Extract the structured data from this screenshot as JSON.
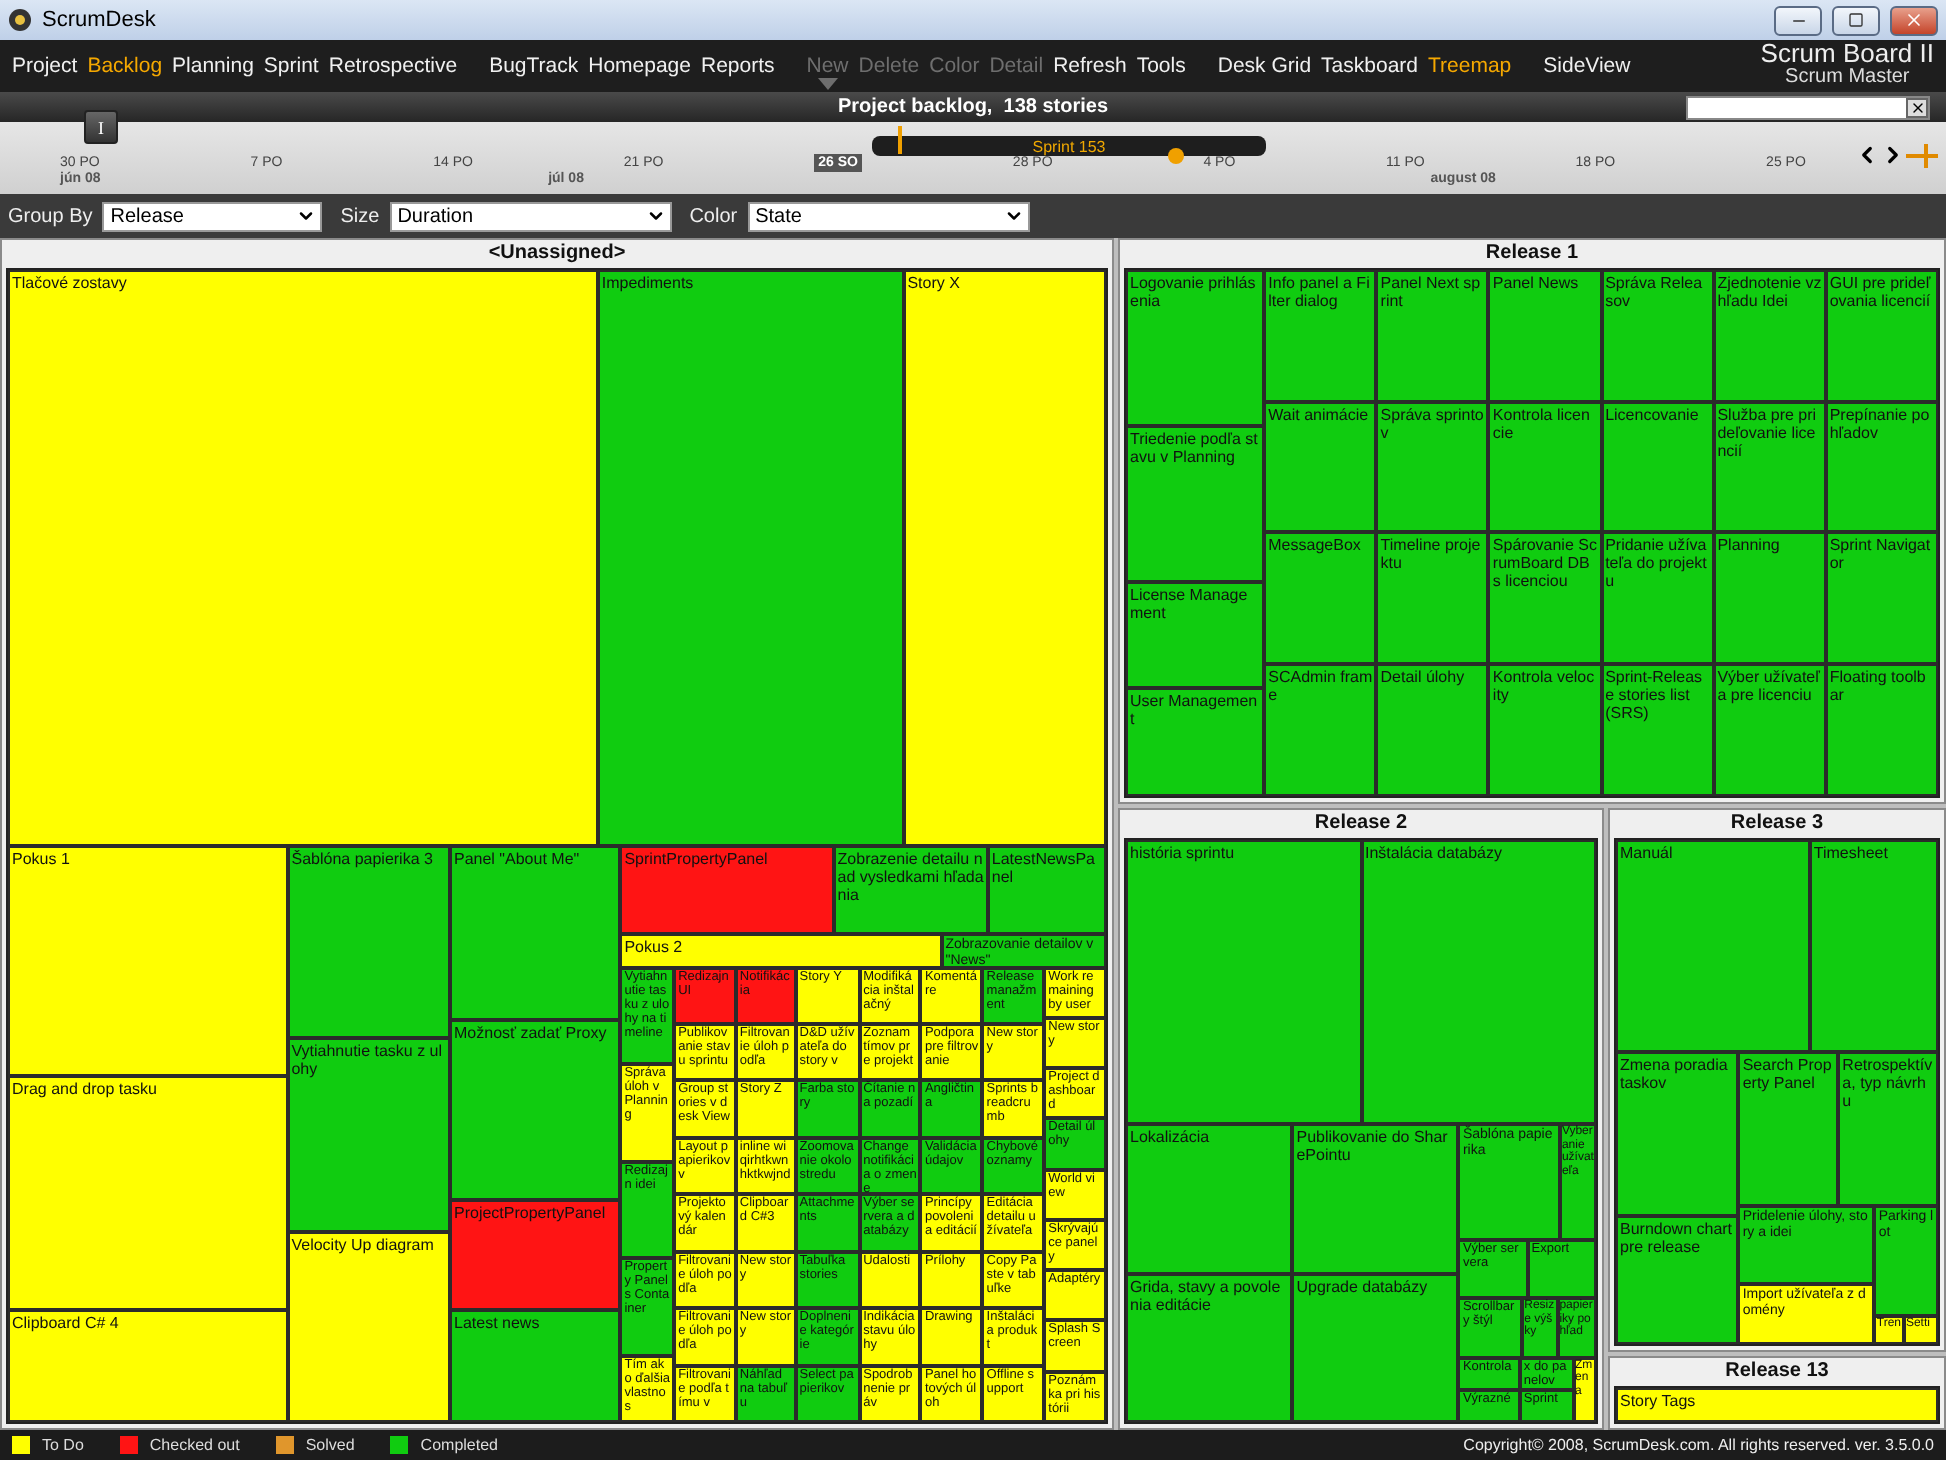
{
  "window": {
    "title": "ScrumDesk"
  },
  "menu": [
    [
      {
        "label": "Project",
        "selected": false,
        "disabled": false
      },
      {
        "label": "Backlog",
        "selected": true,
        "disabled": false
      },
      {
        "label": "Planning",
        "selected": false,
        "disabled": false
      },
      {
        "label": "Sprint",
        "selected": false,
        "disabled": false
      },
      {
        "label": "Retrospective",
        "selected": false,
        "disabled": false
      }
    ],
    [
      {
        "label": "BugTrack",
        "selected": false,
        "disabled": false
      },
      {
        "label": "Homepage",
        "selected": false,
        "disabled": false
      },
      {
        "label": "Reports",
        "selected": false,
        "disabled": false
      }
    ],
    [
      {
        "label": "New",
        "selected": false,
        "disabled": true,
        "dropdown": true
      },
      {
        "label": "Delete",
        "selected": false,
        "disabled": true
      },
      {
        "label": "Color",
        "selected": false,
        "disabled": true
      },
      {
        "label": "Detail",
        "selected": false,
        "disabled": true
      },
      {
        "label": "Refresh",
        "selected": false,
        "disabled": false
      },
      {
        "label": "Tools",
        "selected": false,
        "disabled": false
      }
    ],
    [
      {
        "label": "Desk Grid",
        "selected": false,
        "disabled": false
      },
      {
        "label": "Taskboard",
        "selected": false,
        "disabled": false
      },
      {
        "label": "Treemap",
        "selected": true,
        "disabled": false
      }
    ],
    [
      {
        "label": "SideView",
        "selected": false,
        "disabled": false
      }
    ]
  ],
  "board": {
    "title": "Scrum Board II",
    "role": "Scrum Master"
  },
  "header": {
    "title": "Project backlog,  138 stories"
  },
  "timeline": {
    "button": "I",
    "days": [
      {
        "label": "30 PO",
        "today": false
      },
      {
        "label": "7 PO",
        "today": false
      },
      {
        "label": "14 PO",
        "today": false
      },
      {
        "label": "21 PO",
        "today": false
      },
      {
        "label": "26 SO",
        "today": true
      },
      {
        "label": "28 PO",
        "today": false
      },
      {
        "label": "4 PO",
        "today": false
      },
      {
        "label": "11 PO",
        "today": false
      },
      {
        "label": "18 PO",
        "today": false
      },
      {
        "label": "25 PO",
        "today": false
      }
    ],
    "months": [
      "jún 08",
      "júl 08",
      "august 08"
    ],
    "sprint": {
      "label": "Sprint 153"
    }
  },
  "filters": [
    {
      "label": "Group By",
      "value": "Release"
    },
    {
      "label": "Size",
      "value": "Duration"
    },
    {
      "label": "Color",
      "value": "State"
    }
  ],
  "groups": [
    {
      "title": "<Unassigned>",
      "tiles": [
        {
          "label": "Tlačové zostavy",
          "color": "#ffff00"
        },
        {
          "label": "Impediments",
          "color": "#10cc10"
        },
        {
          "label": "Story X",
          "color": "#ffff00"
        },
        {
          "label": "Pokus 1",
          "color": "#ffff00"
        },
        {
          "label": "Drag and drop tasku",
          "color": "#ffff00"
        },
        {
          "label": "Clipboard C# 4",
          "color": "#ffff00"
        },
        {
          "label": "Šablóna papierika 3",
          "color": "#10cc10"
        },
        {
          "label": "Vytiahnutie tasku z ulohy",
          "color": "#10cc10"
        },
        {
          "label": "Velocity Up diagram",
          "color": "#ffff00"
        },
        {
          "label": "Panel \"About Me\"",
          "color": "#10cc10"
        },
        {
          "label": "Možnosť zadať Proxy",
          "color": "#10cc10"
        },
        {
          "label": "ProjectPropertyPanel",
          "color": "#ff1414"
        },
        {
          "label": "Latest news",
          "color": "#10cc10"
        },
        {
          "label": "SprintPropertyPanel",
          "color": "#ff1414"
        },
        {
          "label": "Zobrazenie detailu nad vysledkami hľadania",
          "color": "#10cc10"
        },
        {
          "label": "LatestNewsPanel",
          "color": "#10cc10"
        },
        {
          "label": "Pokus 2",
          "color": "#ffff00"
        },
        {
          "label": "Zobrazovanie detailov v \"News\"",
          "color": "#10cc10"
        },
        {
          "label": "Vytiahnutie tasku z ulohy na timeline",
          "color": "#10cc10"
        },
        {
          "label": "Správa úloh v Planning",
          "color": "#ffff00"
        },
        {
          "label": "Redizajn idei",
          "color": "#10cc10"
        },
        {
          "label": "Property Panels Container",
          "color": "#10cc10"
        },
        {
          "label": "Tím ako ďalšia vlastnos",
          "color": "#ffff00"
        },
        {
          "label": "Redizajn UI",
          "color": "#ff1414"
        },
        {
          "label": "Publikovanie stavu sprintu",
          "color": "#ffff00"
        },
        {
          "label": "Group stories v desk View",
          "color": "#ffff00"
        },
        {
          "label": "Layout papierikov v",
          "color": "#ffff00"
        },
        {
          "label": "Projektový kalendár",
          "color": "#ffff00"
        },
        {
          "label": "Filtrovanie úloh podľa",
          "color": "#ffff00"
        },
        {
          "label": "Filtrovanie úloh podľa",
          "color": "#ffff00"
        },
        {
          "label": "Filtrovanie podľa tímu v",
          "color": "#ffff00"
        },
        {
          "label": "Notifikácia",
          "color": "#ff1414"
        },
        {
          "label": "Filtrovanie úloh podľa",
          "color": "#ffff00"
        },
        {
          "label": "Story Z",
          "color": "#ffff00"
        },
        {
          "label": "inline wiqirhtkwnhktkwjnd",
          "color": "#ffff00"
        },
        {
          "label": "Clipboard C#3",
          "color": "#ffff00"
        },
        {
          "label": "New story",
          "color": "#ffff00"
        },
        {
          "label": "New story",
          "color": "#ffff00"
        },
        {
          "label": "Náhľad na tabuľu",
          "color": "#10cc10"
        },
        {
          "label": "Story Y",
          "color": "#ffff00"
        },
        {
          "label": "D&D užívateľa do story v",
          "color": "#ffff00"
        },
        {
          "label": "Farba story",
          "color": "#10cc10"
        },
        {
          "label": "Zoomovanie okolo stredu",
          "color": "#10cc10"
        },
        {
          "label": "Attachments",
          "color": "#10cc10"
        },
        {
          "label": "Tabuľka stories",
          "color": "#10cc10"
        },
        {
          "label": "Doplnenie kategórie",
          "color": "#10cc10"
        },
        {
          "label": "Select papierikov",
          "color": "#10cc10"
        },
        {
          "label": "Modifikácia inštalačný",
          "color": "#ffff00"
        },
        {
          "label": "Zoznam tímov pre projekt",
          "color": "#ffff00"
        },
        {
          "label": "Čítanie na pozadí",
          "color": "#10cc10"
        },
        {
          "label": "Change notifikácia o zmene",
          "color": "#10cc10"
        },
        {
          "label": "Výber servera a databázy",
          "color": "#10cc10"
        },
        {
          "label": "Udalosti",
          "color": "#ffff00"
        },
        {
          "label": "Indikácia stavu úlohy",
          "color": "#ffff00"
        },
        {
          "label": "Spodrobnenie práv",
          "color": "#ffff00"
        },
        {
          "label": "Komentáre",
          "color": "#ffff00"
        },
        {
          "label": "Podpora pre filtrovanie",
          "color": "#ffff00"
        },
        {
          "label": "Angličtina",
          "color": "#10cc10"
        },
        {
          "label": "Validácia údajov",
          "color": "#10cc10"
        },
        {
          "label": "Princípy povolenia editácií",
          "color": "#ffff00"
        },
        {
          "label": "Prílohy",
          "color": "#ffff00"
        },
        {
          "label": "Drawing",
          "color": "#ffff00"
        },
        {
          "label": "Panel hotových úloh",
          "color": "#ffff00"
        },
        {
          "label": "Release manažment",
          "color": "#10cc10"
        },
        {
          "label": "New story",
          "color": "#ffff00"
        },
        {
          "label": "Sprints breadcrumb",
          "color": "#ffff00"
        },
        {
          "label": "Chybové oznamy",
          "color": "#10cc10"
        },
        {
          "label": "Editácia detailu užívateľa",
          "color": "#ffff00"
        },
        {
          "label": "Copy Paste v tabuľke",
          "color": "#ffff00"
        },
        {
          "label": "Inštalácia produkt",
          "color": "#ffff00"
        },
        {
          "label": "Offline support",
          "color": "#ffff00"
        },
        {
          "label": "Work remaining by user",
          "color": "#ffff00"
        },
        {
          "label": "New story",
          "color": "#ffff00"
        },
        {
          "label": "Project dashboard",
          "color": "#ffff00"
        },
        {
          "label": "Detail úlohy",
          "color": "#10cc10"
        },
        {
          "label": "World view",
          "color": "#ffff00"
        },
        {
          "label": "Skrývajúce panely",
          "color": "#ffff00"
        },
        {
          "label": "Adaptéry",
          "color": "#ffff00"
        },
        {
          "label": "Splash Screen",
          "color": "#ffff00"
        },
        {
          "label": "Poznámka pri histórii",
          "color": "#ffff00"
        }
      ]
    },
    {
      "title": "Release 1",
      "tiles": [
        {
          "label": "Logovanie prihlásenia",
          "color": "#10cc10"
        },
        {
          "label": "Triedenie podľa stavu v Planning",
          "color": "#10cc10"
        },
        {
          "label": "License Management",
          "color": "#10cc10"
        },
        {
          "label": "User Management",
          "color": "#10cc10"
        },
        {
          "label": "Info panel a Filter dialog",
          "color": "#10cc10"
        },
        {
          "label": "Panel Next sprint",
          "color": "#10cc10"
        },
        {
          "label": "Panel News",
          "color": "#10cc10"
        },
        {
          "label": "Správa Releasov",
          "color": "#10cc10"
        },
        {
          "label": "Zjednotenie vzhľadu Idei",
          "color": "#10cc10"
        },
        {
          "label": "GUI pre prideľovania licencií",
          "color": "#10cc10"
        },
        {
          "label": "Wait animácie",
          "color": "#10cc10"
        },
        {
          "label": "Správa sprintov",
          "color": "#10cc10"
        },
        {
          "label": "Kontrola licencie",
          "color": "#10cc10"
        },
        {
          "label": "Licencovanie",
          "color": "#10cc10"
        },
        {
          "label": "Služba pre prideľovanie licencií",
          "color": "#10cc10"
        },
        {
          "label": "Prepínanie pohľadov",
          "color": "#10cc10"
        },
        {
          "label": "MessageBox",
          "color": "#10cc10"
        },
        {
          "label": "Timeline projektu",
          "color": "#10cc10"
        },
        {
          "label": "Spárovanie ScrumBoard DB s licenciou",
          "color": "#10cc10"
        },
        {
          "label": "Pridanie užívateľa do projektu",
          "color": "#10cc10"
        },
        {
          "label": "Planning",
          "color": "#10cc10"
        },
        {
          "label": "Sprint Navigator",
          "color": "#10cc10"
        },
        {
          "label": "SCAdmin frame",
          "color": "#10cc10"
        },
        {
          "label": "Detail úlohy",
          "color": "#10cc10"
        },
        {
          "label": "Kontrola velocity",
          "color": "#10cc10"
        },
        {
          "label": "Sprint-Release stories list (SRS)",
          "color": "#10cc10"
        },
        {
          "label": "Výber užívateľa pre licenciu",
          "color": "#10cc10"
        },
        {
          "label": "Floating toolbar",
          "color": "#10cc10"
        }
      ]
    },
    {
      "title": "Release 2",
      "tiles": [
        {
          "label": "história sprintu",
          "color": "#10cc10"
        },
        {
          "label": "Inštalácia databázy",
          "color": "#10cc10"
        },
        {
          "label": "Lokalizácia",
          "color": "#10cc10"
        },
        {
          "label": "Grida, stavy a povolenia editácie",
          "color": "#10cc10"
        },
        {
          "label": "Publikovanie do SharePointu",
          "color": "#10cc10"
        },
        {
          "label": "Upgrade databázy",
          "color": "#10cc10"
        },
        {
          "label": "Šablóna papierika",
          "color": "#10cc10"
        },
        {
          "label": "Vyberanie užívateľa",
          "color": "#10cc10"
        },
        {
          "label": "Výber servera",
          "color": "#10cc10"
        },
        {
          "label": "Export",
          "color": "#10cc10"
        },
        {
          "label": "Scrollbary štýl",
          "color": "#10cc10"
        },
        {
          "label": "Resize výšky",
          "color": "#10cc10"
        },
        {
          "label": "papieriky pohľad",
          "color": "#10cc10"
        },
        {
          "label": "Kontrola",
          "color": "#10cc10"
        },
        {
          "label": "Výrazné",
          "color": "#10cc10"
        },
        {
          "label": "x do panelov",
          "color": "#10cc10"
        },
        {
          "label": "Sprint",
          "color": "#10cc10"
        },
        {
          "label": "Zmena",
          "color": "#ffff00"
        }
      ]
    },
    {
      "title": "Release 3",
      "tiles": [
        {
          "label": "Manuál",
          "color": "#10cc10"
        },
        {
          "label": "Timesheet",
          "color": "#10cc10"
        },
        {
          "label": "Zmena poradia taskov",
          "color": "#10cc10"
        },
        {
          "label": "Burndown chart pre release",
          "color": "#10cc10"
        },
        {
          "label": "Search Property Panel",
          "color": "#10cc10"
        },
        {
          "label": "Retrospektíva, typ návrhu",
          "color": "#10cc10"
        },
        {
          "label": "Pridelenie úlohy, story a idei",
          "color": "#10cc10"
        },
        {
          "label": "Import užívateľa z domény",
          "color": "#ffff00"
        },
        {
          "label": "Parking lot",
          "color": "#10cc10"
        },
        {
          "label": "Tren",
          "color": "#ffff00"
        },
        {
          "label": "Setti",
          "color": "#ffff00"
        }
      ]
    },
    {
      "title": "Release 13",
      "tiles": [
        {
          "label": "Story Tags",
          "color": "#ffff00"
        }
      ]
    }
  ],
  "legend": [
    {
      "label": "To Do",
      "color": "#ffff00"
    },
    {
      "label": "Checked out",
      "color": "#ff1414"
    },
    {
      "label": "Solved",
      "color": "#e0962c"
    },
    {
      "label": "Completed",
      "color": "#10cc10"
    }
  ],
  "copyright": "Copyright© 2008, ScrumDesk.com. All rights reserved. ver. 3.5.0.0"
}
